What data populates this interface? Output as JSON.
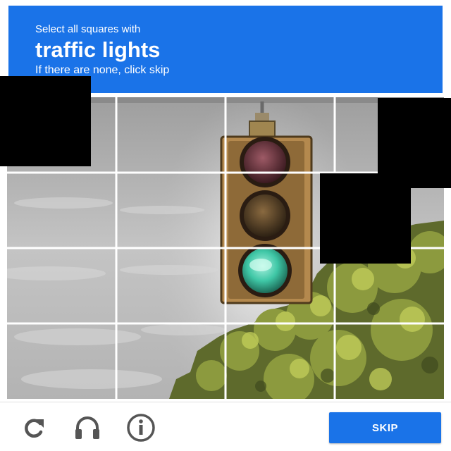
{
  "header": {
    "prompt": "Select all squares with",
    "target": "traffic lights",
    "hint": "If there are none, click skip"
  },
  "grid": {
    "rows": 4,
    "cols": 4
  },
  "footer": {
    "reload_icon": "reload-icon",
    "audio_icon": "headphones-icon",
    "info_icon": "info-icon",
    "skip_label": "SKIP"
  },
  "colors": {
    "accent": "#1a73e8",
    "signal_green": "#3fc7a6"
  }
}
